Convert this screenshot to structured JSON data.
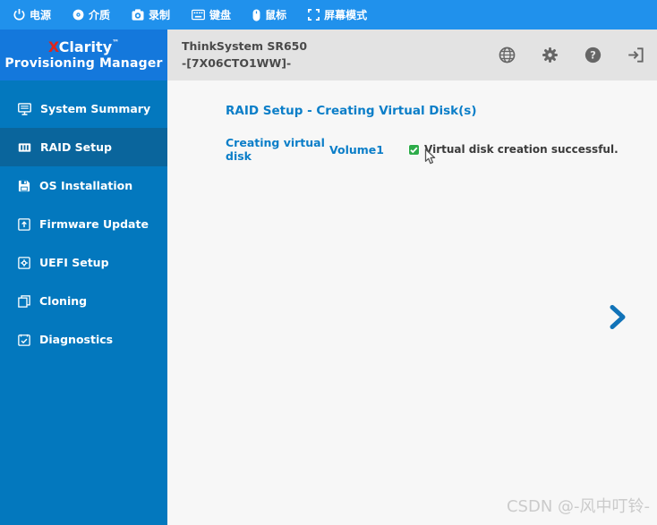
{
  "toolbar": {
    "items": [
      {
        "icon": "power-icon",
        "label": "电源"
      },
      {
        "icon": "disc-icon",
        "label": "介质"
      },
      {
        "icon": "camera-icon",
        "label": "录制"
      },
      {
        "icon": "keyboard-icon",
        "label": "键盘"
      },
      {
        "icon": "mouse-icon",
        "label": "鼠标"
      },
      {
        "icon": "fullscreen-icon",
        "label": "屏幕模式"
      }
    ]
  },
  "logo": {
    "brand_prefix": "X",
    "brand_suffix": "Clarity",
    "trademark": "™",
    "subtitle": "Provisioning Manager"
  },
  "header": {
    "system_model": "ThinkSystem SR650",
    "system_serial": "-[7X06CTO1WW]-"
  },
  "sidebar": {
    "selected_item": "RAID Setup",
    "items": [
      {
        "icon": "system-summary-icon",
        "label": "System Summary"
      },
      {
        "icon": "raid-setup-icon",
        "label": "RAID Setup"
      },
      {
        "icon": "os-installation-icon",
        "label": "OS Installation"
      },
      {
        "icon": "firmware-update-icon",
        "label": "Firmware Update"
      },
      {
        "icon": "uefi-setup-icon",
        "label": "UEFI Setup"
      },
      {
        "icon": "cloning-icon",
        "label": "Cloning"
      },
      {
        "icon": "diagnostics-icon",
        "label": "Diagnostics"
      }
    ]
  },
  "main": {
    "title": "RAID Setup - Creating Virtual Disk(s)",
    "task_label": "Creating virtual disk",
    "volume_name": "Volume1",
    "status_message": "Virtual disk creation successful."
  },
  "watermark": "CSDN @-风中叮铃-",
  "colors": {
    "topbar_blue": "#2091EC",
    "logo_blue": "#1478DC",
    "sidebar_blue": "#0378BE",
    "sidebar_selected_blue": "#0A659C",
    "header_gray": "#E3E3E3",
    "content_background": "#F7F7F7",
    "accent_blue_text": "#0B7EC8",
    "success_green": "#2EAC4A",
    "brand_red": "#E1251B",
    "next_chevron_blue": "#1173B8"
  }
}
